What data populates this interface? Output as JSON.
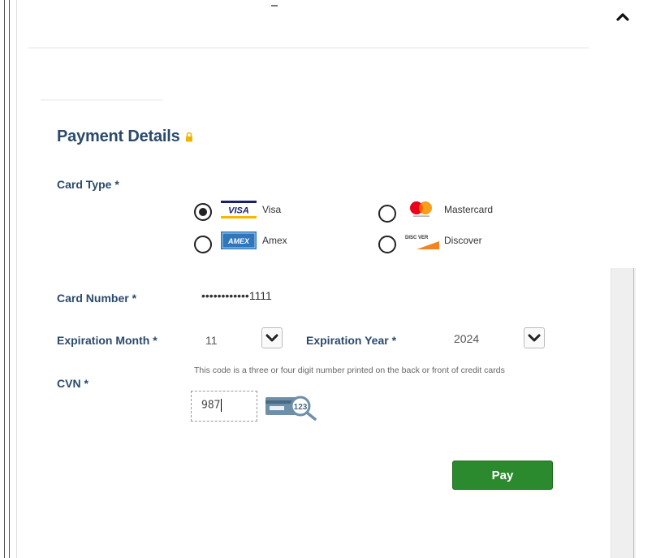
{
  "section_title": "Payment Details",
  "card_type": {
    "label": "Card Type *",
    "options": [
      {
        "name": "Visa",
        "logo_text": "VISA",
        "selected": true
      },
      {
        "name": "Mastercard",
        "selected": false
      },
      {
        "name": "Amex",
        "logo_text": "AMEX",
        "selected": false
      },
      {
        "name": "Discover",
        "logo_text": "DISC VER",
        "selected": false
      }
    ]
  },
  "card_number": {
    "label": "Card Number *",
    "value": "••••••••••••1111"
  },
  "expiration_month": {
    "label": "Expiration Month *",
    "value": "11"
  },
  "expiration_year": {
    "label": "Expiration Year *",
    "value": "2024"
  },
  "cvn": {
    "label": "CVN *",
    "help_text": "This code is a three or four digit number printed on the back or front of credit cards",
    "value": "987",
    "icon_text": "123"
  },
  "pay_button": {
    "label": "Pay"
  },
  "colors": {
    "heading": "#2b4a6b",
    "pay_button": "#2c8a2e",
    "lock": "#f0b400"
  }
}
